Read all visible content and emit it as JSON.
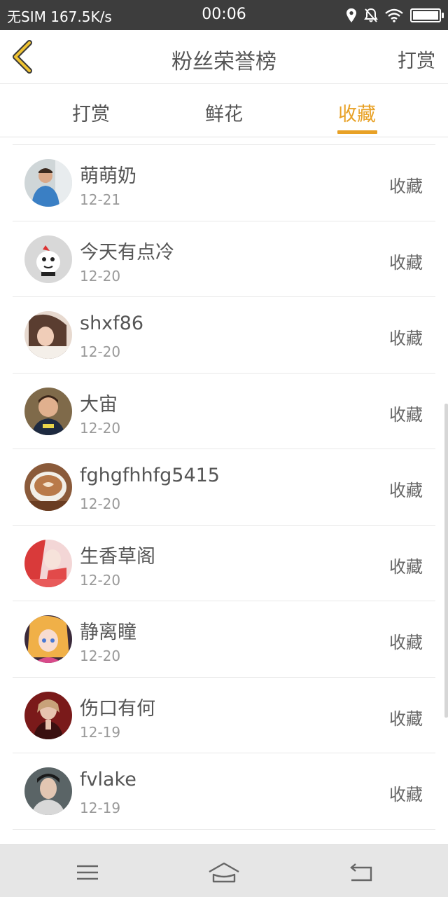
{
  "status_bar": {
    "carrier": "无SIM",
    "net_speed": "167.5K/s",
    "time": "00:06",
    "icons": [
      "location-icon",
      "mute-bell-icon",
      "wifi-icon",
      "battery-icon"
    ],
    "battery_level": 1.0
  },
  "header": {
    "title": "粉丝荣誉榜",
    "action": "打赏",
    "back_icon": "chevron-left-icon"
  },
  "tabs": [
    {
      "label": "打赏",
      "active": false
    },
    {
      "label": "鲜花",
      "active": false
    },
    {
      "label": "收藏",
      "active": true
    }
  ],
  "list": [
    {
      "name": "萌萌奶",
      "date": "12-21",
      "action": "收藏"
    },
    {
      "name": "今天有点冷",
      "date": "12-20",
      "action": "收藏"
    },
    {
      "name": "shxf86",
      "date": "12-20",
      "action": "收藏"
    },
    {
      "name": "大宙",
      "date": "12-20",
      "action": "收藏"
    },
    {
      "name": "fghgfhhfg5415",
      "date": "12-20",
      "action": "收藏"
    },
    {
      "name": "生香草阁",
      "date": "12-20",
      "action": "收藏"
    },
    {
      "name": "静离瞳",
      "date": "12-20",
      "action": "收藏"
    },
    {
      "name": "伤口有何",
      "date": "12-19",
      "action": "收藏"
    },
    {
      "name": "fvlake",
      "date": "12-19",
      "action": "收藏"
    }
  ],
  "navbar": {
    "icons": [
      "menu-icon",
      "home-icon",
      "back-icon"
    ]
  },
  "colors": {
    "accent": "#e8a126",
    "status_bar_bg": "#3d3d3d",
    "nav_bar_bg": "#e6e6e6"
  }
}
